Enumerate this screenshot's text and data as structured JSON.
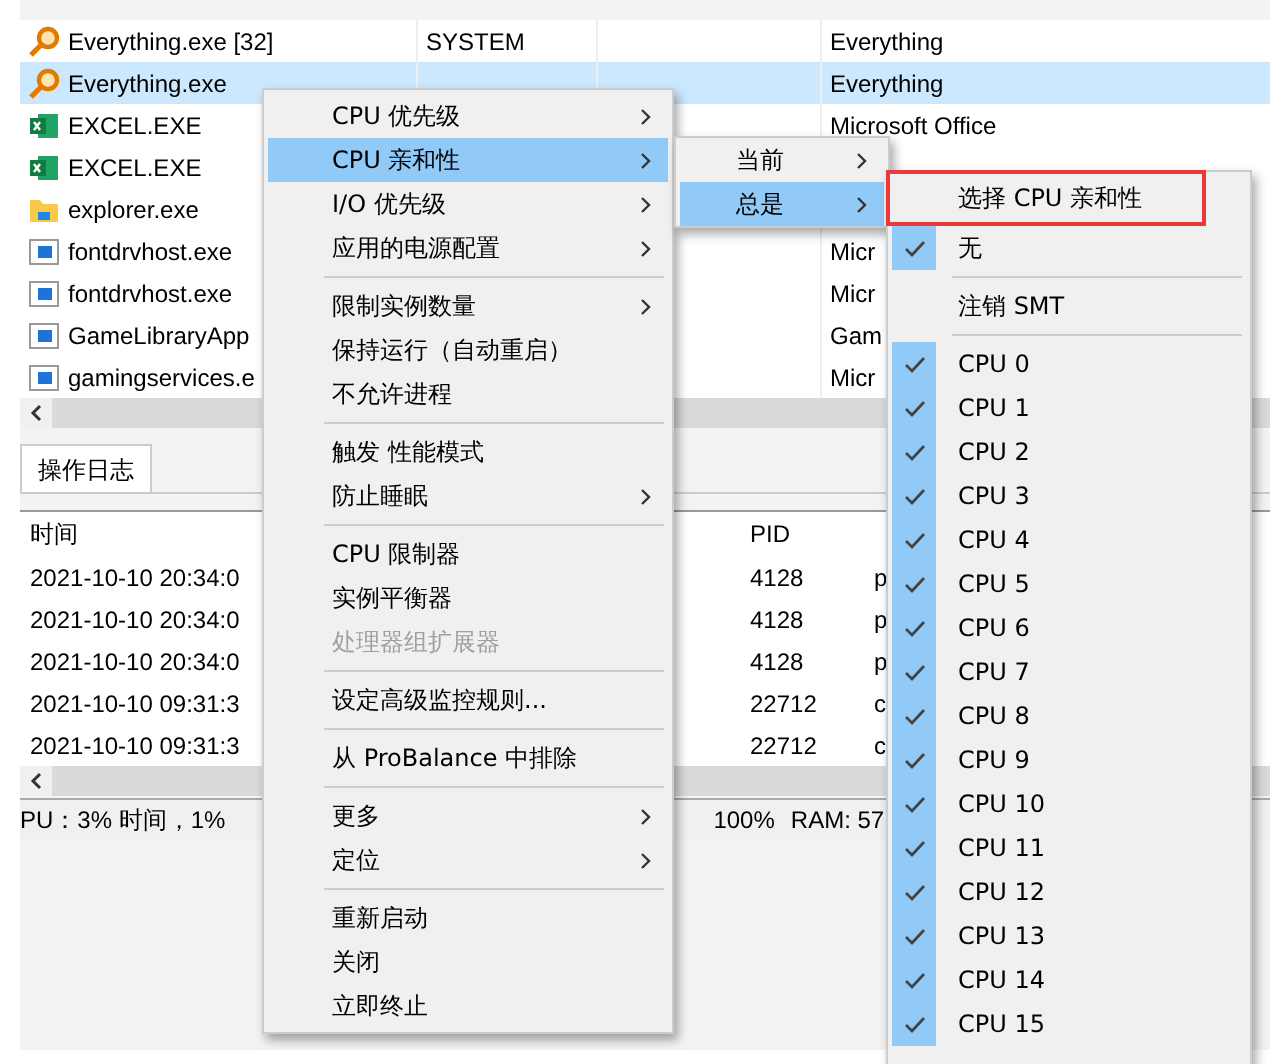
{
  "processes": [
    {
      "kind": "magnifier",
      "name": "Everything.exe [32]",
      "user": "SYSTEM",
      "description": "Everything",
      "selected": false
    },
    {
      "kind": "magnifier",
      "name": "Everything.exe",
      "description": "Everything",
      "selected": true
    },
    {
      "kind": "spreadsheet",
      "name": "EXCEL.EXE",
      "description": "Microsoft Office",
      "selected": false
    },
    {
      "kind": "spreadsheet",
      "name": "EXCEL.EXE",
      "selected": false
    },
    {
      "kind": "folder",
      "name": "explorer.exe",
      "selected": false
    },
    {
      "kind": "program",
      "name": "fontdrvhost.exe",
      "description": "Micr",
      "selected": false
    },
    {
      "kind": "program",
      "name": "fontdrvhost.exe",
      "description": "Micr",
      "selected": false
    },
    {
      "kind": "program",
      "name": "GameLibraryApp",
      "description": "Gam",
      "selected": false
    },
    {
      "kind": "program",
      "name": "gamingservices.e",
      "description": "Micr",
      "selected": false
    }
  ],
  "log": {
    "tab": "操作日志",
    "columns": [
      "时间",
      "PID"
    ],
    "rows": [
      {
        "time": "2021-10-10 20:34:0",
        "pid": "4128",
        "process": "p"
      },
      {
        "time": "2021-10-10 20:34:0",
        "pid": "4128",
        "process": "p"
      },
      {
        "time": "2021-10-10 20:34:0",
        "pid": "4128",
        "process": "p"
      },
      {
        "time": "2021-10-10 09:31:3",
        "pid": "22712",
        "process": "c"
      },
      {
        "time": "2021-10-10 09:31:3",
        "pid": "22712",
        "process": "c"
      }
    ]
  },
  "status_bar": {
    "cpu": "PU：3% 时间，1%",
    "load": "100%",
    "ram": "RAM: 57"
  },
  "context_menu": {
    "items": [
      {
        "kind": "item",
        "label": "CPU 优先级",
        "submenu": true,
        "selected": false,
        "disabled": false
      },
      {
        "kind": "item",
        "label": "CPU 亲和性",
        "submenu": true,
        "selected": true,
        "disabled": false
      },
      {
        "kind": "item",
        "label": "I/O 优先级",
        "submenu": true,
        "selected": false,
        "disabled": false
      },
      {
        "kind": "item",
        "label": "应用的电源配置",
        "submenu": true,
        "selected": false,
        "disabled": false
      },
      {
        "kind": "separator"
      },
      {
        "kind": "item",
        "label": "限制实例数量",
        "submenu": true,
        "selected": false,
        "disabled": false
      },
      {
        "kind": "item",
        "label": "保持运行（自动重启）",
        "submenu": false,
        "selected": false,
        "disabled": false
      },
      {
        "kind": "item",
        "label": "不允许进程",
        "submenu": false,
        "selected": false,
        "disabled": false
      },
      {
        "kind": "separator"
      },
      {
        "kind": "item",
        "label": "触发 性能模式",
        "submenu": false,
        "selected": false,
        "disabled": false
      },
      {
        "kind": "item",
        "label": "防止睡眠",
        "submenu": true,
        "selected": false,
        "disabled": false
      },
      {
        "kind": "separator"
      },
      {
        "kind": "item",
        "label": "CPU 限制器",
        "submenu": false,
        "selected": false,
        "disabled": false
      },
      {
        "kind": "item",
        "label": "实例平衡器",
        "submenu": false,
        "selected": false,
        "disabled": false
      },
      {
        "kind": "item",
        "label": "处理器组扩展器",
        "submenu": false,
        "selected": false,
        "disabled": true
      },
      {
        "kind": "separator"
      },
      {
        "kind": "item",
        "label": "设定高级监控规则...",
        "submenu": false,
        "selected": false,
        "disabled": false
      },
      {
        "kind": "separator"
      },
      {
        "kind": "item",
        "label": "从 ProBalance 中排除",
        "submenu": false,
        "selected": false,
        "disabled": false
      },
      {
        "kind": "separator"
      },
      {
        "kind": "item",
        "label": "更多",
        "submenu": true,
        "selected": false,
        "disabled": false
      },
      {
        "kind": "item",
        "label": "定位",
        "submenu": true,
        "selected": false,
        "disabled": false
      },
      {
        "kind": "separator"
      },
      {
        "kind": "item",
        "label": "重新启动",
        "submenu": false,
        "selected": false,
        "disabled": false
      },
      {
        "kind": "item",
        "label": "关闭",
        "submenu": false,
        "selected": false,
        "disabled": false
      },
      {
        "kind": "item",
        "label": "立即终止",
        "submenu": false,
        "selected": false,
        "disabled": false
      }
    ]
  },
  "affinity_menu": {
    "items": [
      {
        "kind": "item",
        "label": "当前",
        "submenu": true,
        "selected": false
      },
      {
        "kind": "item",
        "label": "总是",
        "submenu": true,
        "selected": true
      }
    ]
  },
  "cpu_menu": {
    "items": [
      {
        "kind": "item",
        "label": "选择 CPU 亲和性",
        "checked": false,
        "annotated": true
      },
      {
        "kind": "item",
        "label": "无",
        "checked": true,
        "annotated": false
      },
      {
        "kind": "separator"
      },
      {
        "kind": "item",
        "label": "注销 SMT",
        "checked": false,
        "annotated": false
      },
      {
        "kind": "separator"
      },
      {
        "kind": "item",
        "label": "CPU 0",
        "checked": true,
        "annotated": false
      },
      {
        "kind": "item",
        "label": "CPU 1",
        "checked": true,
        "annotated": false
      },
      {
        "kind": "item",
        "label": "CPU 2",
        "checked": true,
        "annotated": false
      },
      {
        "kind": "item",
        "label": "CPU 3",
        "checked": true,
        "annotated": false
      },
      {
        "kind": "item",
        "label": "CPU 4",
        "checked": true,
        "annotated": false
      },
      {
        "kind": "item",
        "label": "CPU 5",
        "checked": true,
        "annotated": false
      },
      {
        "kind": "item",
        "label": "CPU 6",
        "checked": true,
        "annotated": false
      },
      {
        "kind": "item",
        "label": "CPU 7",
        "checked": true,
        "annotated": false
      },
      {
        "kind": "item",
        "label": "CPU 8",
        "checked": true,
        "annotated": false
      },
      {
        "kind": "item",
        "label": "CPU 9",
        "checked": true,
        "annotated": false
      },
      {
        "kind": "item",
        "label": "CPU 10",
        "checked": true,
        "annotated": false
      },
      {
        "kind": "item",
        "label": "CPU 11",
        "checked": true,
        "annotated": false
      },
      {
        "kind": "item",
        "label": "CPU 12",
        "checked": true,
        "annotated": false
      },
      {
        "kind": "item",
        "label": "CPU 13",
        "checked": true,
        "annotated": false
      },
      {
        "kind": "item",
        "label": "CPU 14",
        "checked": true,
        "annotated": false
      },
      {
        "kind": "item",
        "label": "CPU 15",
        "checked": true,
        "annotated": false
      }
    ]
  }
}
